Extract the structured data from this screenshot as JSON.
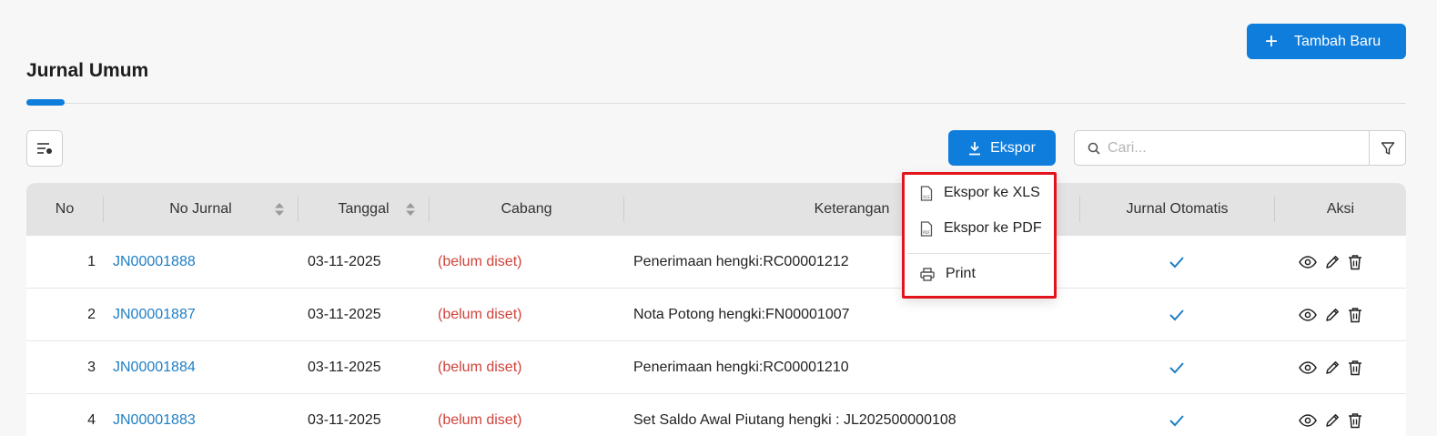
{
  "header": {
    "title": "Jurnal Umum",
    "add_button_label": "Tambah Baru",
    "add_button_icon": "plus-icon"
  },
  "toolbar": {
    "column_settings_icon": "column-settings-icon",
    "export_label": "Ekspor",
    "export_icon": "download-icon",
    "search_placeholder": "Cari...",
    "filter_icon": "filter-icon"
  },
  "export_menu": {
    "items": [
      {
        "label": "Ekspor ke XLS",
        "icon": "xls-file-icon"
      },
      {
        "label": "Ekspor ke PDF",
        "icon": "pdf-file-icon"
      },
      {
        "label": "Print",
        "icon": "printer-icon"
      }
    ]
  },
  "table": {
    "columns": [
      "No",
      "No Jurnal",
      "Tanggal",
      "Cabang",
      "Keterangan",
      "Jurnal Otomatis",
      "Aksi"
    ],
    "rows": [
      {
        "no": "1",
        "no_jurnal": "JN00001888",
        "tanggal": "03-11-2025",
        "cabang": "(belum diset)",
        "keterangan": "Penerimaan hengki:RC00001212",
        "otomatis": true
      },
      {
        "no": "2",
        "no_jurnal": "JN00001887",
        "tanggal": "03-11-2025",
        "cabang": "(belum diset)",
        "keterangan": "Nota Potong hengki:FN00001007",
        "otomatis": true
      },
      {
        "no": "3",
        "no_jurnal": "JN00001884",
        "tanggal": "03-11-2025",
        "cabang": "(belum diset)",
        "keterangan": "Penerimaan hengki:RC00001210",
        "otomatis": true
      },
      {
        "no": "4",
        "no_jurnal": "JN00001883",
        "tanggal": "03-11-2025",
        "cabang": "(belum diset)",
        "keterangan": "Set Saldo Awal Piutang hengki : JL202500000108",
        "otomatis": true
      }
    ],
    "row_actions": [
      "eye-icon",
      "pencil-icon",
      "trash-icon"
    ]
  },
  "colors": {
    "primary": "#0f7ddb",
    "link": "#1f7fc4",
    "warning_text": "#d0433b",
    "highlight_border": "#e3131b"
  }
}
